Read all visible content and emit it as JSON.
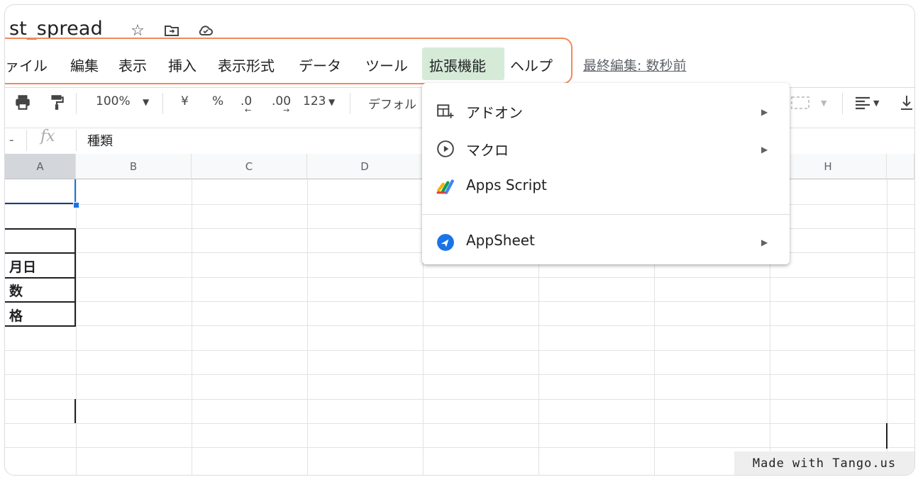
{
  "document": {
    "title": "st_spread"
  },
  "menu": {
    "items": [
      "ァイル",
      "編集",
      "表示",
      "挿入",
      "表示形式",
      "データ",
      "ツール",
      "拡張機能",
      "ヘルプ"
    ],
    "active": "拡張機能",
    "last_edit": "最終編集: 数秒前"
  },
  "toolbar": {
    "zoom": "100%",
    "currency": "¥",
    "percent": "%",
    "dec_decrease": ".0",
    "dec_increase": ".00",
    "format_number": "123",
    "font": "デフォル"
  },
  "formula_bar": {
    "fx": "fx",
    "content": "種類",
    "name_box": "-"
  },
  "sheet": {
    "columns": [
      "A",
      "B",
      "C",
      "D",
      "H"
    ],
    "cells": [
      "月日",
      "数",
      "格"
    ]
  },
  "extensions_menu": {
    "items": [
      {
        "label": "アドオン",
        "submenu": true
      },
      {
        "label": "マクロ",
        "submenu": true
      },
      {
        "label": "Apps Script",
        "submenu": false
      },
      {
        "label": "AppSheet",
        "submenu": true
      }
    ]
  },
  "watermark": "Made with Tango.us",
  "colors": {
    "highlight_border": "#f08a5d",
    "active_menu_bg": "#d5ebd8",
    "selection_blue": "#1a73e8"
  }
}
